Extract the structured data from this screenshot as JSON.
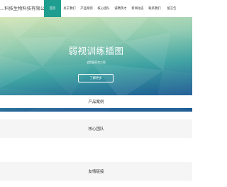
{
  "header": {
    "logo_text": "…科技生物科技有限公司",
    "nav": [
      {
        "label": "首页",
        "active": true
      },
      {
        "label": "关于我们",
        "active": false
      },
      {
        "label": "产品案例",
        "active": false
      },
      {
        "label": "核心团队",
        "active": false
      },
      {
        "label": "诚聘英才",
        "active": false
      },
      {
        "label": "新闻动态",
        "active": false
      },
      {
        "label": "联系我们",
        "active": false
      },
      {
        "label": "留言告",
        "active": false
      }
    ]
  },
  "hero": {
    "title": "弱视训练插图",
    "subtitle": "追踪器研究方案",
    "button_label": "了解更多"
  },
  "sections": [
    {
      "label": "产品案例"
    },
    {
      "label": "核心团队"
    },
    {
      "label": "友情链接"
    }
  ],
  "colors": {
    "accent": "#1f9e90",
    "hero_top": "#c9dfa8",
    "hero_mid": "#2e9c9a",
    "hero_bottom": "#1d5e93"
  }
}
